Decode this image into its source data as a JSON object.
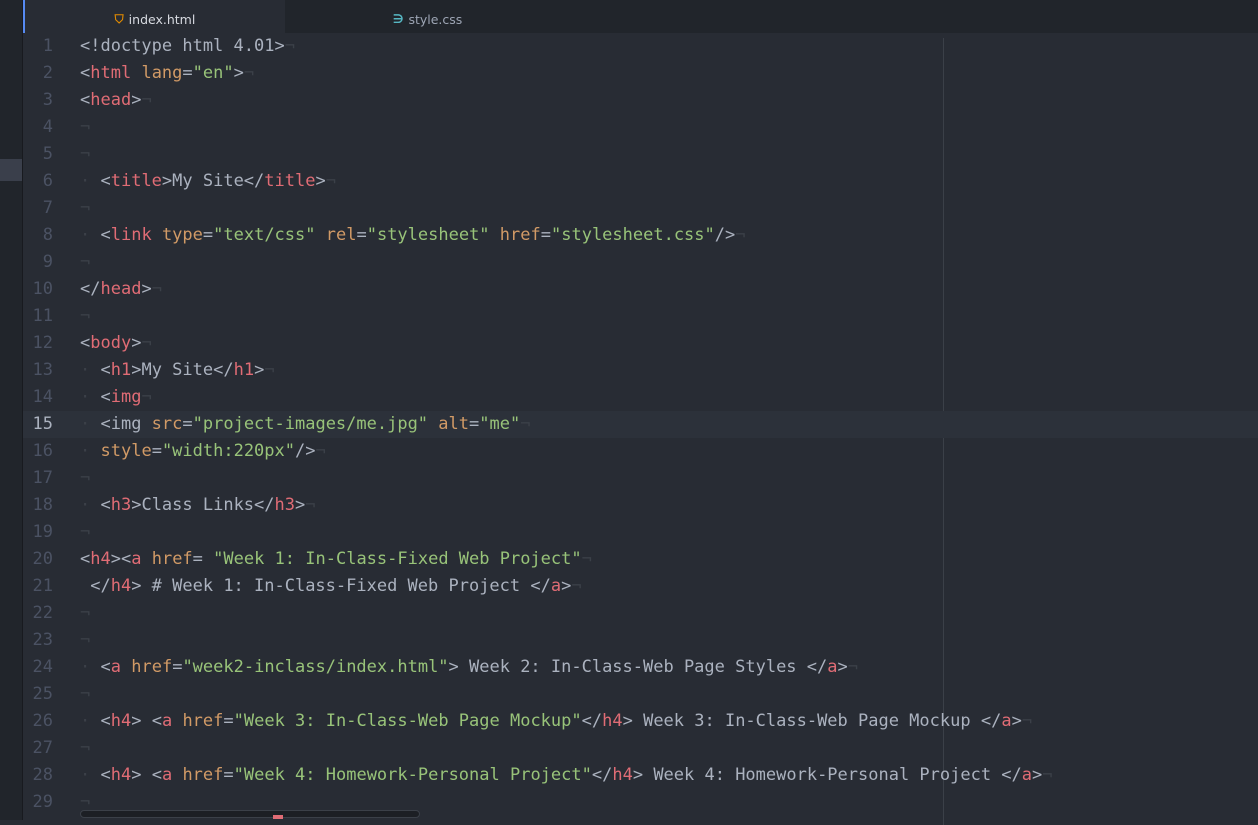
{
  "tabs": [
    {
      "label": "index.html",
      "icon": "html5-file-icon",
      "active": true
    },
    {
      "label": "style.css",
      "icon": "css3-file-icon",
      "active": false
    }
  ],
  "cursor_line": 15,
  "eol_marker": "¬",
  "indent_marker": "·",
  "colors": {
    "background": "#282c34",
    "tag": "#e06c75",
    "attribute": "#d19a66",
    "string": "#98c379",
    "text": "#abb2bf",
    "gutter": "#4b5263",
    "tab_accent": "#568af2"
  },
  "lines": [
    {
      "n": "1",
      "indent": false,
      "tokens": [
        {
          "c": "p",
          "v": "<!doctype html 4.01>"
        }
      ]
    },
    {
      "n": "2",
      "indent": false,
      "tokens": [
        {
          "c": "p",
          "v": "<"
        },
        {
          "c": "t",
          "v": "html"
        },
        {
          "c": "p",
          "v": " "
        },
        {
          "c": "a",
          "v": "lang"
        },
        {
          "c": "p",
          "v": "="
        },
        {
          "c": "s",
          "v": "\"en\""
        },
        {
          "c": "p",
          "v": ">"
        }
      ]
    },
    {
      "n": "3",
      "indent": false,
      "tokens": [
        {
          "c": "p",
          "v": "<"
        },
        {
          "c": "t",
          "v": "head"
        },
        {
          "c": "p",
          "v": ">"
        }
      ]
    },
    {
      "n": "4",
      "indent": false,
      "tokens": []
    },
    {
      "n": "5",
      "indent": false,
      "tokens": []
    },
    {
      "n": "6",
      "indent": true,
      "tokens": [
        {
          "c": "p",
          "v": " <"
        },
        {
          "c": "t",
          "v": "title"
        },
        {
          "c": "p",
          "v": ">My Site</"
        },
        {
          "c": "t",
          "v": "title"
        },
        {
          "c": "p",
          "v": ">"
        }
      ]
    },
    {
      "n": "7",
      "indent": false,
      "tokens": []
    },
    {
      "n": "8",
      "indent": true,
      "tokens": [
        {
          "c": "p",
          "v": " <"
        },
        {
          "c": "t",
          "v": "link"
        },
        {
          "c": "p",
          "v": " "
        },
        {
          "c": "a",
          "v": "type"
        },
        {
          "c": "p",
          "v": "="
        },
        {
          "c": "s",
          "v": "\"text/css\""
        },
        {
          "c": "p",
          "v": " "
        },
        {
          "c": "a",
          "v": "rel"
        },
        {
          "c": "p",
          "v": "="
        },
        {
          "c": "s",
          "v": "\"stylesheet\""
        },
        {
          "c": "p",
          "v": " "
        },
        {
          "c": "a",
          "v": "href"
        },
        {
          "c": "p",
          "v": "="
        },
        {
          "c": "s",
          "v": "\"stylesheet.css\""
        },
        {
          "c": "p",
          "v": "/>"
        }
      ]
    },
    {
      "n": "9",
      "indent": false,
      "tokens": []
    },
    {
      "n": "10",
      "indent": false,
      "tokens": [
        {
          "c": "p",
          "v": "</"
        },
        {
          "c": "t",
          "v": "head"
        },
        {
          "c": "p",
          "v": ">"
        }
      ]
    },
    {
      "n": "11",
      "indent": false,
      "tokens": []
    },
    {
      "n": "12",
      "indent": false,
      "tokens": [
        {
          "c": "p",
          "v": "<"
        },
        {
          "c": "t",
          "v": "body"
        },
        {
          "c": "p",
          "v": ">"
        }
      ]
    },
    {
      "n": "13",
      "indent": true,
      "tokens": [
        {
          "c": "p",
          "v": " <"
        },
        {
          "c": "t",
          "v": "h1"
        },
        {
          "c": "p",
          "v": ">My Site</"
        },
        {
          "c": "t",
          "v": "h1"
        },
        {
          "c": "p",
          "v": ">"
        }
      ]
    },
    {
      "n": "14",
      "indent": true,
      "tokens": [
        {
          "c": "p",
          "v": " <"
        },
        {
          "c": "t",
          "v": "img"
        }
      ]
    },
    {
      "n": "15",
      "indent": true,
      "tokens": [
        {
          "c": "p",
          "v": " <img "
        },
        {
          "c": "a",
          "v": "src"
        },
        {
          "c": "p",
          "v": "="
        },
        {
          "c": "s",
          "v": "\"project-images/me.jpg\""
        },
        {
          "c": "p",
          "v": " "
        },
        {
          "c": "a",
          "v": "alt"
        },
        {
          "c": "p",
          "v": "="
        },
        {
          "c": "s",
          "v": "\"me\""
        }
      ]
    },
    {
      "n": "16",
      "indent": true,
      "tokens": [
        {
          "c": "p",
          "v": " "
        },
        {
          "c": "a",
          "v": "style"
        },
        {
          "c": "p",
          "v": "="
        },
        {
          "c": "s",
          "v": "\"width:220px\""
        },
        {
          "c": "p",
          "v": "/>"
        }
      ]
    },
    {
      "n": "17",
      "indent": false,
      "tokens": []
    },
    {
      "n": "18",
      "indent": true,
      "tokens": [
        {
          "c": "p",
          "v": " <"
        },
        {
          "c": "t",
          "v": "h3"
        },
        {
          "c": "p",
          "v": ">Class Links</"
        },
        {
          "c": "t",
          "v": "h3"
        },
        {
          "c": "p",
          "v": ">"
        }
      ]
    },
    {
      "n": "19",
      "indent": false,
      "tokens": []
    },
    {
      "n": "20",
      "indent": false,
      "tokens": [
        {
          "c": "p",
          "v": "<"
        },
        {
          "c": "t",
          "v": "h4"
        },
        {
          "c": "p",
          "v": "><"
        },
        {
          "c": "t",
          "v": "a"
        },
        {
          "c": "p",
          "v": " "
        },
        {
          "c": "a",
          "v": "href"
        },
        {
          "c": "p",
          "v": "= "
        },
        {
          "c": "s",
          "v": "\"Week 1: In-Class-Fixed Web Project\""
        }
      ]
    },
    {
      "n": "21",
      "indent": false,
      "tokens": [
        {
          "c": "p",
          "v": " </"
        },
        {
          "c": "t",
          "v": "h4"
        },
        {
          "c": "p",
          "v": "> # Week 1: In-Class-Fixed Web Project </"
        },
        {
          "c": "t",
          "v": "a"
        },
        {
          "c": "p",
          "v": ">"
        }
      ]
    },
    {
      "n": "22",
      "indent": false,
      "tokens": []
    },
    {
      "n": "23",
      "indent": false,
      "tokens": []
    },
    {
      "n": "24",
      "indent": true,
      "tokens": [
        {
          "c": "p",
          "v": " <"
        },
        {
          "c": "t",
          "v": "a"
        },
        {
          "c": "p",
          "v": " "
        },
        {
          "c": "a",
          "v": "href"
        },
        {
          "c": "p",
          "v": "="
        },
        {
          "c": "s",
          "v": "\"week2-inclass/index.html\""
        },
        {
          "c": "p",
          "v": "> Week 2: In-Class-Web Page Styles </"
        },
        {
          "c": "t",
          "v": "a"
        },
        {
          "c": "p",
          "v": ">"
        }
      ]
    },
    {
      "n": "25",
      "indent": false,
      "tokens": []
    },
    {
      "n": "26",
      "indent": true,
      "tokens": [
        {
          "c": "p",
          "v": " <"
        },
        {
          "c": "t",
          "v": "h4"
        },
        {
          "c": "p",
          "v": "> <"
        },
        {
          "c": "t",
          "v": "a"
        },
        {
          "c": "p",
          "v": " "
        },
        {
          "c": "a",
          "v": "href"
        },
        {
          "c": "p",
          "v": "="
        },
        {
          "c": "s",
          "v": "\"Week 3: In-Class-Web Page Mockup\""
        },
        {
          "c": "p",
          "v": "</"
        },
        {
          "c": "t",
          "v": "h4"
        },
        {
          "c": "p",
          "v": "> Week 3: In-Class-Web Page Mockup </"
        },
        {
          "c": "t",
          "v": "a"
        },
        {
          "c": "p",
          "v": ">"
        }
      ]
    },
    {
      "n": "27",
      "indent": false,
      "tokens": []
    },
    {
      "n": "28",
      "indent": true,
      "tokens": [
        {
          "c": "p",
          "v": " <"
        },
        {
          "c": "t",
          "v": "h4"
        },
        {
          "c": "p",
          "v": "> <"
        },
        {
          "c": "t",
          "v": "a"
        },
        {
          "c": "p",
          "v": " "
        },
        {
          "c": "a",
          "v": "href"
        },
        {
          "c": "p",
          "v": "="
        },
        {
          "c": "s",
          "v": "\"Week 4: Homework-Personal Project\""
        },
        {
          "c": "p",
          "v": "</"
        },
        {
          "c": "t",
          "v": "h4"
        },
        {
          "c": "p",
          "v": "> Week 4: Homework-Personal Project </"
        },
        {
          "c": "t",
          "v": "a"
        },
        {
          "c": "p",
          "v": ">"
        }
      ]
    },
    {
      "n": "29",
      "indent": false,
      "tokens": []
    }
  ]
}
